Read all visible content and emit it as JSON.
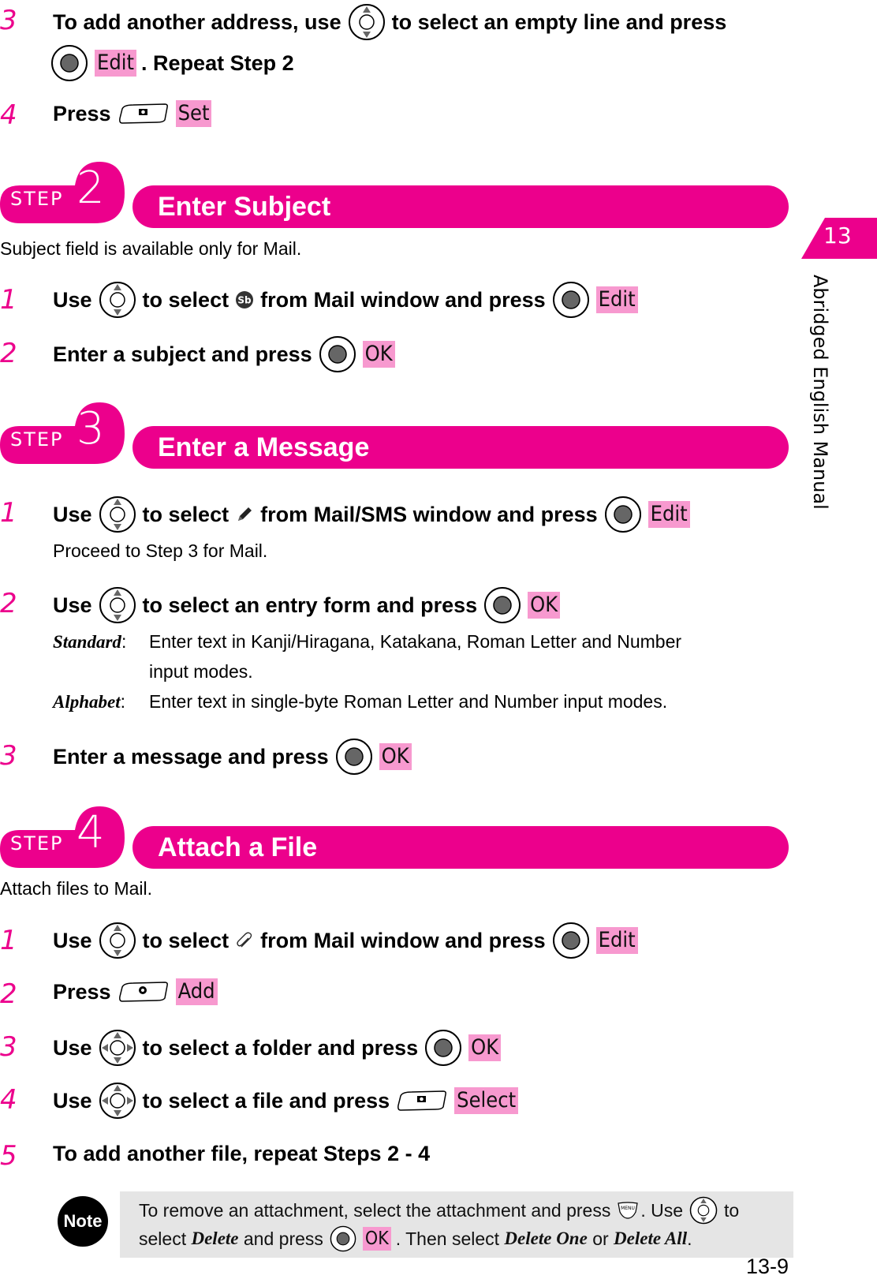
{
  "side_tab": {
    "chapter": "13",
    "label": "Abridged English Manual"
  },
  "colors": {
    "accent": "#ec008c",
    "softkey_bg": "#f799cf",
    "note_bg": "#e5e5e5"
  },
  "top_steps": [
    {
      "num": "3",
      "text_a": "To add another address, use",
      "text_b": "to select an empty line and press",
      "softkey": "Edit",
      "text_c": ". Repeat Step 2"
    },
    {
      "num": "4",
      "text_a": "Press",
      "softkey": "Set"
    }
  ],
  "sections": [
    {
      "step_label": "STEP",
      "step_num": "2",
      "title": "Enter Subject",
      "intro": "Subject field is available only for Mail.",
      "items": [
        {
          "num": "1",
          "text_a": "Use",
          "text_b": "to select",
          "icon": "subject-icon",
          "text_c": "from Mail window and press",
          "softkey": "Edit"
        },
        {
          "num": "2",
          "text_a": "Enter a subject and press",
          "softkey": "OK"
        }
      ]
    },
    {
      "step_label": "STEP",
      "step_num": "3",
      "title": "Enter a Message",
      "items": [
        {
          "num": "1",
          "text_a": "Use",
          "text_b": "to select",
          "icon": "pencil-icon",
          "text_c": "from Mail/SMS window and press",
          "softkey": "Edit",
          "sub": "Proceed to Step 3 for Mail."
        },
        {
          "num": "2",
          "text_a": "Use",
          "text_b": "to select an entry form and press",
          "softkey": "OK",
          "definitions": [
            {
              "term": "Standard",
              "desc1": "Enter text in Kanji/Hiragana, Katakana, Roman Letter and Number",
              "desc2": "input modes."
            },
            {
              "term": "Alphabet",
              "desc1": "Enter text in single-byte Roman Letter and Number input modes."
            }
          ]
        },
        {
          "num": "3",
          "text_a": "Enter a message and press",
          "softkey": "OK"
        }
      ]
    },
    {
      "step_label": "STEP",
      "step_num": "4",
      "title": "Attach a File",
      "intro": "Attach files to Mail.",
      "items": [
        {
          "num": "1",
          "text_a": "Use",
          "text_b": "to select",
          "icon": "paperclip-icon",
          "text_c": "from Mail window and press",
          "softkey": "Edit"
        },
        {
          "num": "2",
          "text_a": "Press",
          "softkey": "Add"
        },
        {
          "num": "3",
          "text_a": "Use",
          "text_b": "to select a folder and press",
          "softkey": "OK"
        },
        {
          "num": "4",
          "text_a": "Use",
          "text_b": "to select a file and press",
          "softkey": "Select"
        },
        {
          "num": "5",
          "text_a": "To add another file, repeat Steps 2 - 4"
        }
      ]
    }
  ],
  "note": {
    "badge": "Note",
    "line1_a": "To remove an attachment, select the attachment and press",
    "line1_b": ". Use",
    "line1_c": "to",
    "line2_a": "select",
    "line2_em1": "Delete",
    "line2_b": "and press",
    "line2_softkey": "OK",
    "line2_c": ". Then select",
    "line2_em2": "Delete One",
    "line2_d": "or",
    "line2_em3": "Delete All",
    "line2_e": "."
  },
  "page_number": "13-9"
}
